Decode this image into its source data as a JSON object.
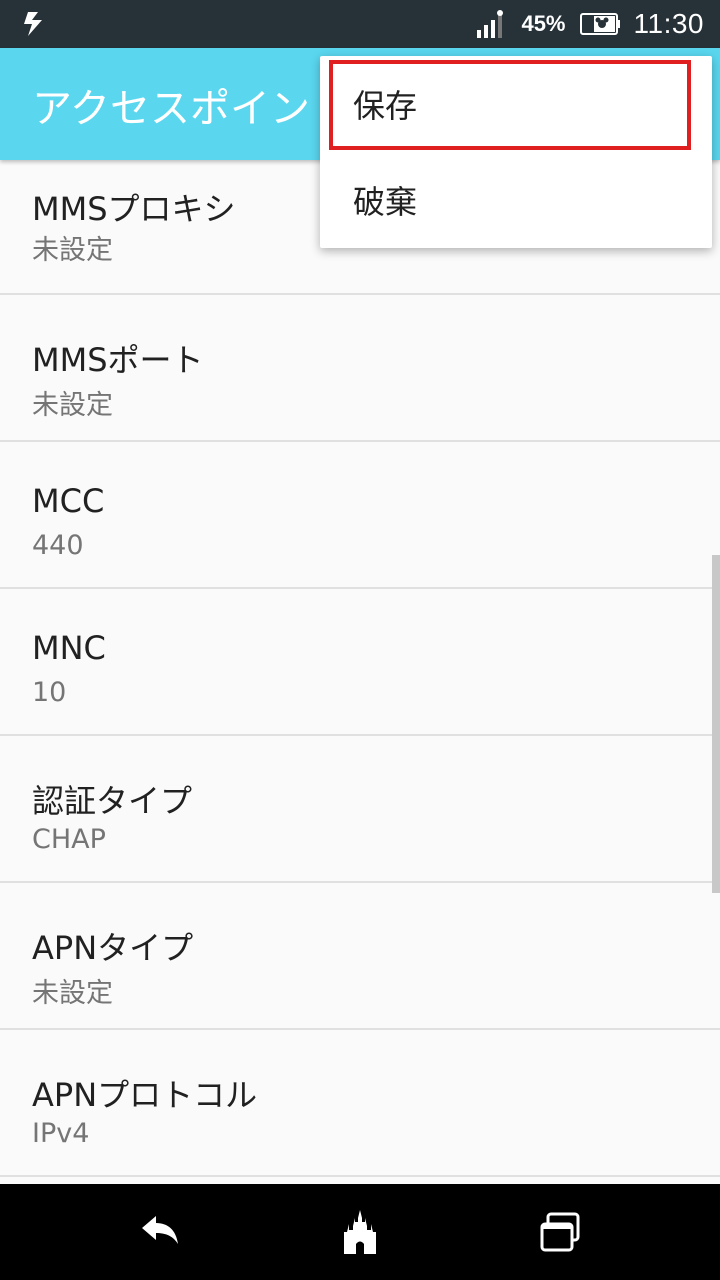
{
  "status_bar": {
    "battery": "45%",
    "time": "11:30",
    "icons": [
      "notification-icon",
      "signal-icon",
      "battery-icon"
    ]
  },
  "app_bar": {
    "title": "アクセスポイン"
  },
  "menu": {
    "save_label": "保存",
    "discard_label": "破棄",
    "highlight_color": "#e02020"
  },
  "settings": [
    {
      "title": "MMSプロキシ",
      "value": "未設定"
    },
    {
      "title": "MMSポート",
      "value": "未設定"
    },
    {
      "title": "MCC",
      "value": "440"
    },
    {
      "title": "MNC",
      "value": "10"
    },
    {
      "title": "認証タイプ",
      "value": "CHAP"
    },
    {
      "title": "APNタイプ",
      "value": "未設定"
    },
    {
      "title": "APNプロトコル",
      "value": "IPv4"
    }
  ],
  "nav_bar": {
    "icons": [
      "back-icon",
      "home-castle-icon",
      "recent-apps-icon"
    ]
  },
  "colors": {
    "app_bar": "#5ad7ef",
    "status_bar": "#263238"
  }
}
